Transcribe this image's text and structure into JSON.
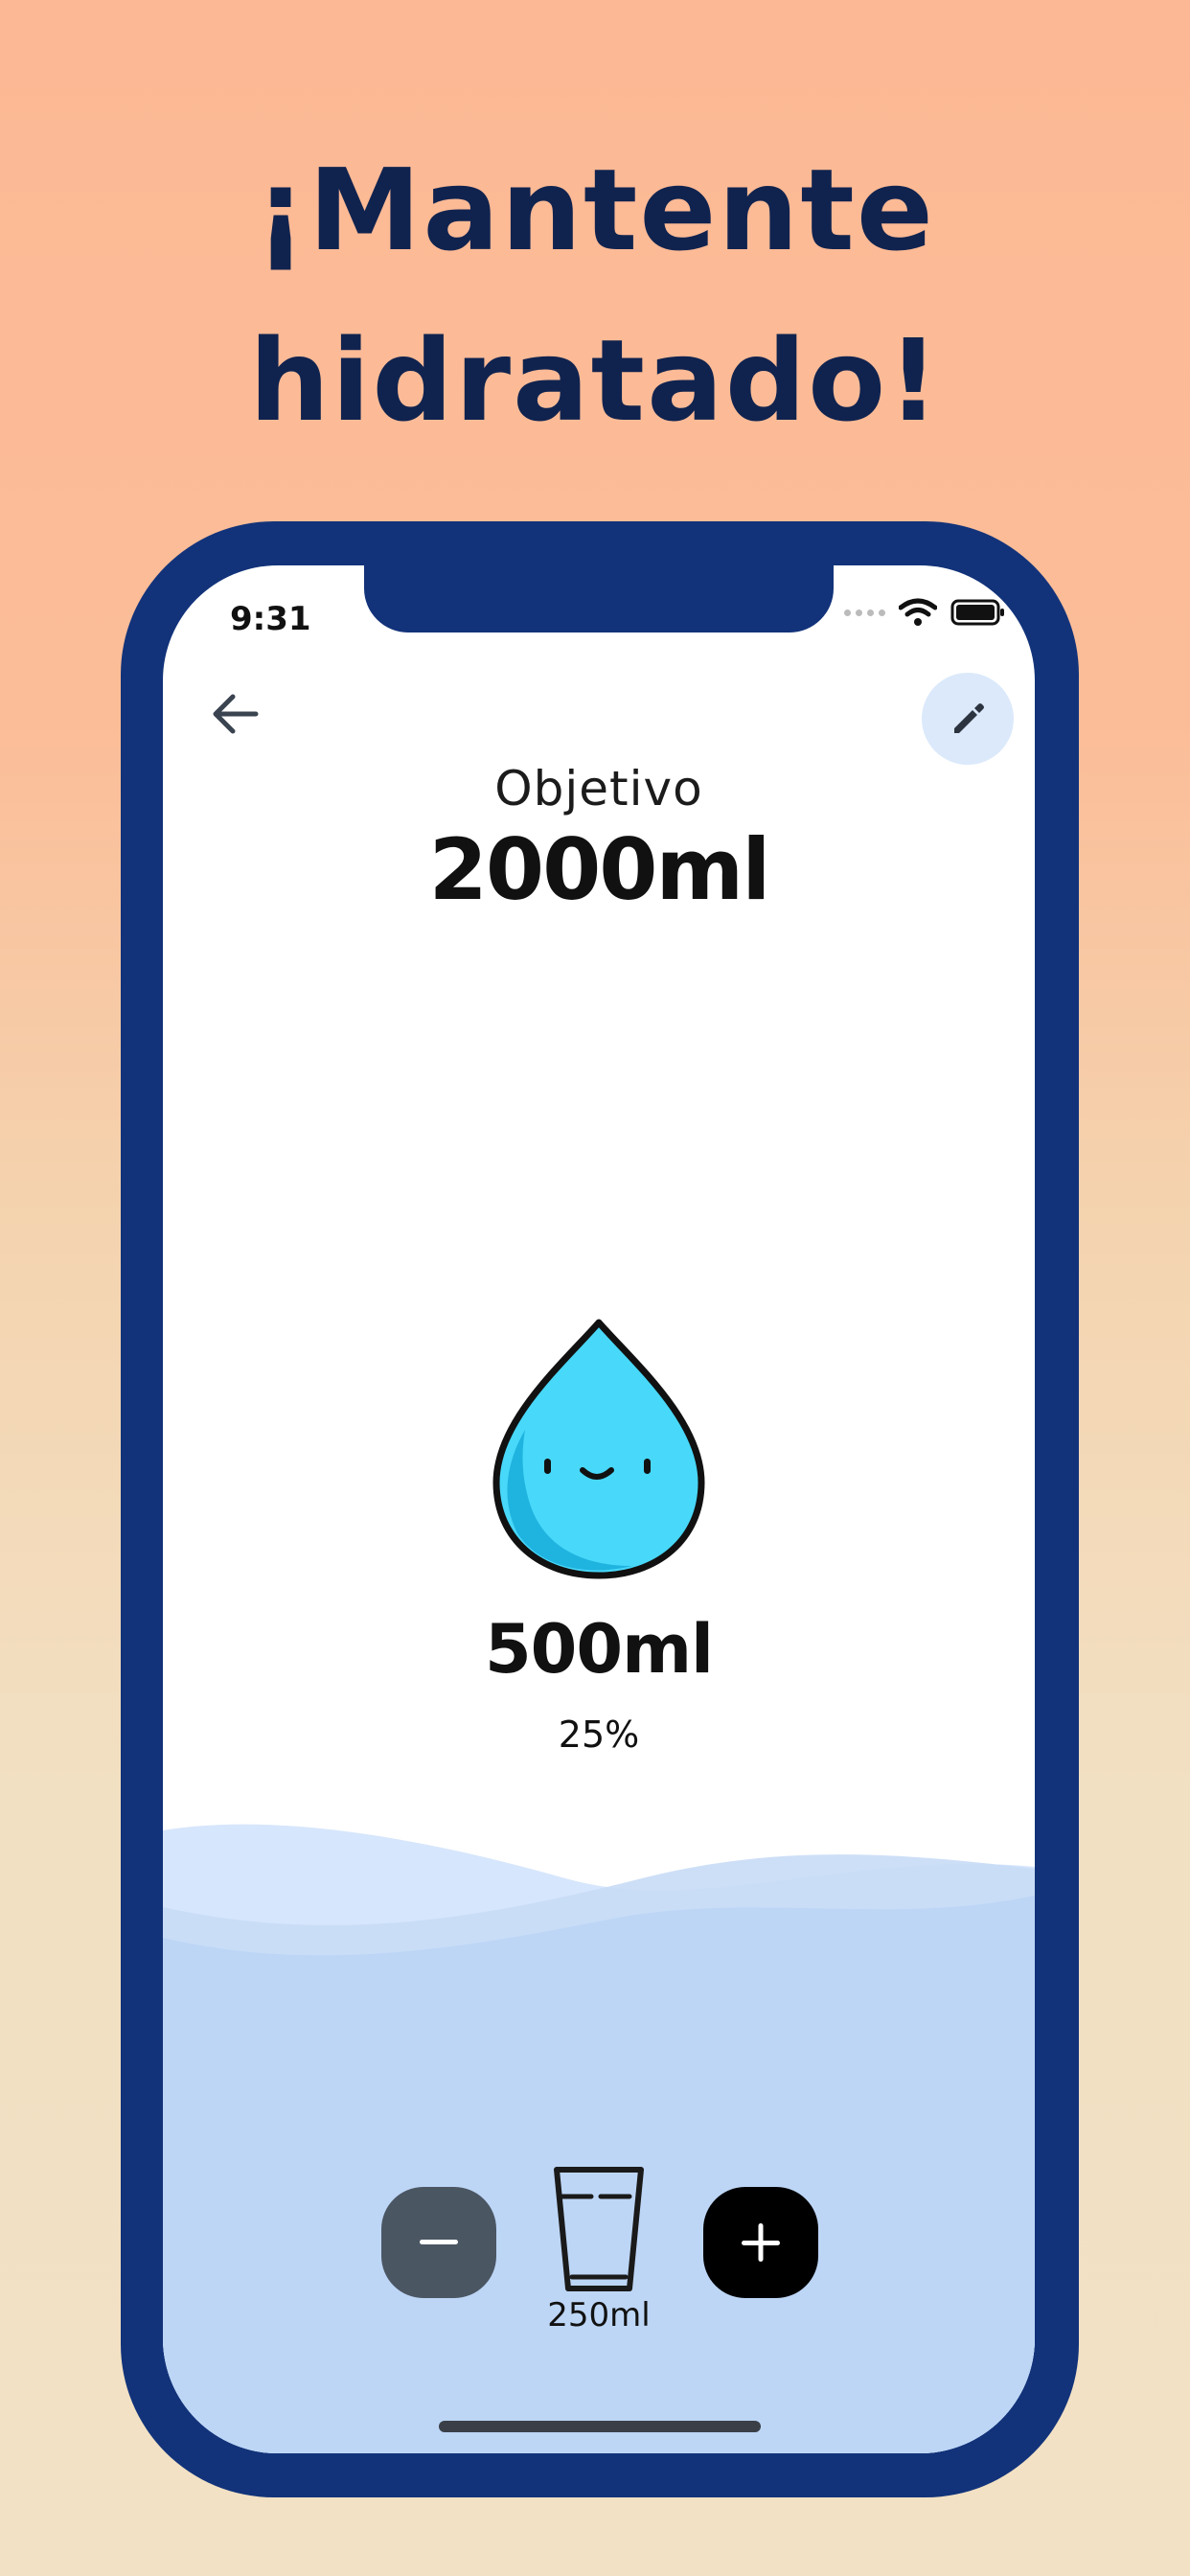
{
  "headline": {
    "line1": "¡Mantente",
    "line2": "hidratado!"
  },
  "status_bar": {
    "time": "9:31"
  },
  "header": {
    "back_icon": "arrow-left-icon",
    "edit_icon": "pencil-icon"
  },
  "goal": {
    "label": "Objetivo",
    "value": "2000ml"
  },
  "progress": {
    "amount": "500ml",
    "percent_text": "25%",
    "fraction": 0.25,
    "mascot_icon": "water-drop-face-icon"
  },
  "controls": {
    "minus_symbol": "−",
    "plus_symbol": "+",
    "serving_size": "250ml",
    "serving_icon": "glass-icon"
  },
  "colors": {
    "frame": "#12337a",
    "headline": "#10234f",
    "drop": "#48d8f9",
    "drop_shadow": "#20b4e0",
    "wave_light": "#d6e6fc",
    "wave_mid": "#c9ddf6",
    "water": "#bdd6f6",
    "minus_button": "#4b5663",
    "plus_button": "#000000"
  }
}
